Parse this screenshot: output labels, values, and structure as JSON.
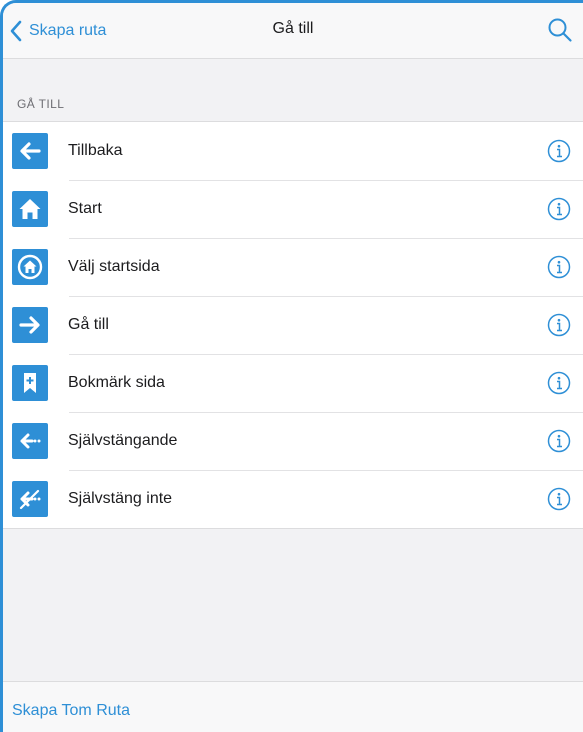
{
  "navbar": {
    "back_label": "Skapa ruta",
    "title": "Gå till",
    "search_icon": "search-icon"
  },
  "section": {
    "header": "GÅ TILL",
    "items": [
      {
        "label": "Tillbaka",
        "icon": "arrow-left-icon"
      },
      {
        "label": "Start",
        "icon": "home-icon"
      },
      {
        "label": "Välj startsida",
        "icon": "home-circle-icon"
      },
      {
        "label": "Gå till",
        "icon": "arrow-right-icon"
      },
      {
        "label": "Bokmärk sida",
        "icon": "bookmark-add-icon"
      },
      {
        "label": "Självstängande",
        "icon": "arrow-left-dots-icon"
      },
      {
        "label": "Självstäng inte",
        "icon": "arrow-left-crossed-icon"
      }
    ]
  },
  "footer": {
    "link_label": "Skapa Tom Ruta"
  },
  "colors": {
    "accent": "#2e8fd6",
    "background": "#f2f2f4",
    "text": "#1c1c1e",
    "secondary_text": "#6d6d72"
  }
}
